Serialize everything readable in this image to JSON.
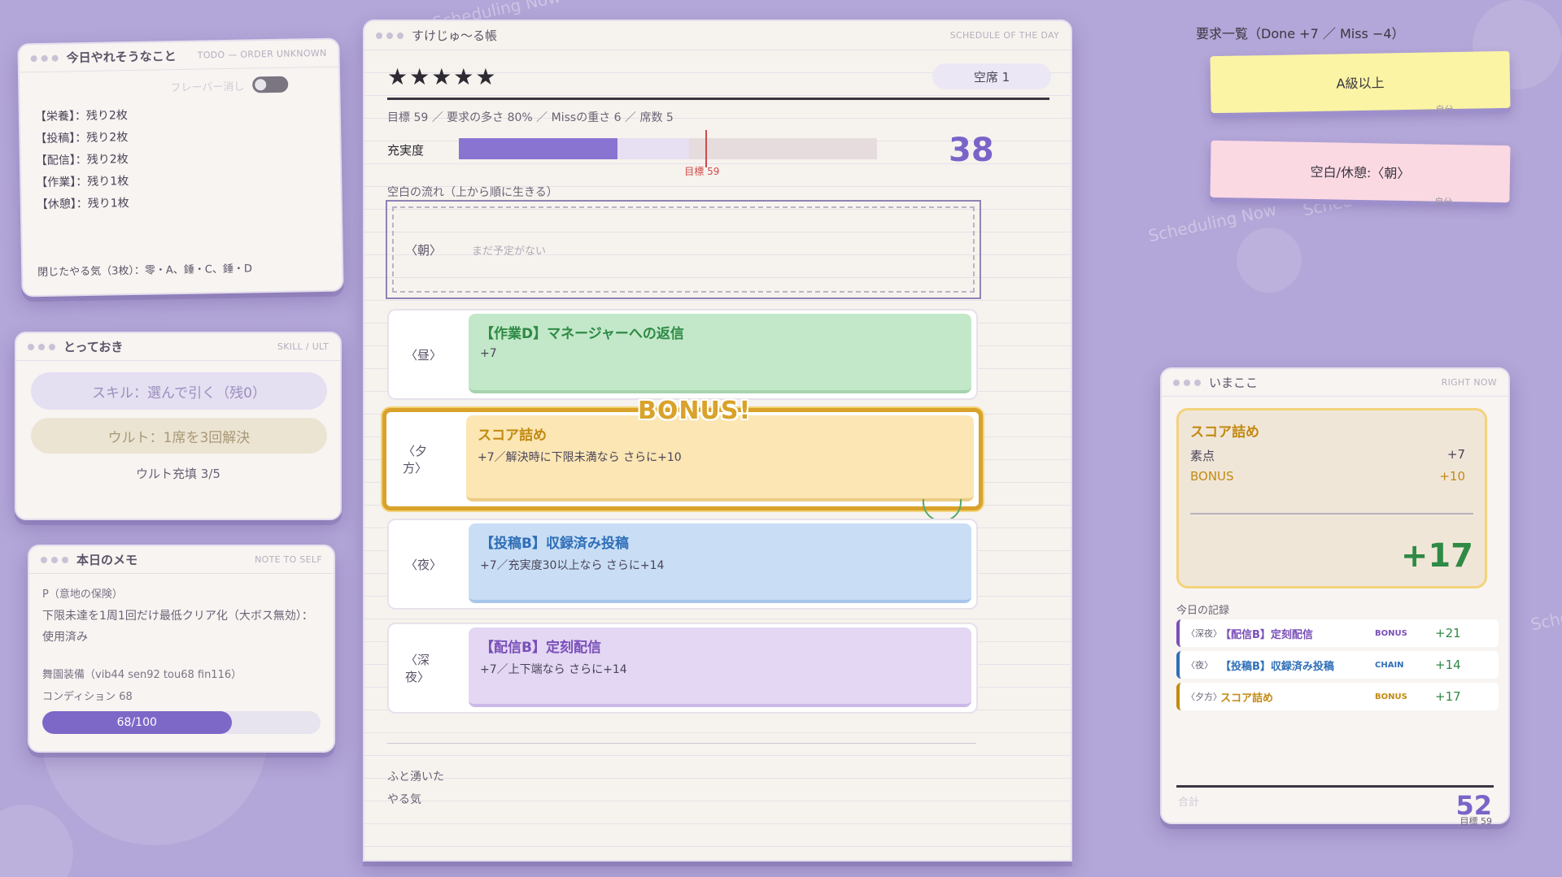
{
  "background": {
    "watermark": [
      "Scheduling Now",
      "Scheduling Now",
      "Scheduling Now",
      "Scheduling Now"
    ]
  },
  "todo": {
    "title": "今日やれそうなこと",
    "subtitle": "TODO — ORDER UNKNOWN",
    "toggle_label": "フレーバー消し",
    "items": [
      "【栄養】：残り2枚",
      "【投稿】：残り2枚",
      "【配信】：残り2枚",
      "【作業】：残り1枚",
      "【休憩】：残り1枚"
    ],
    "footer": "閉じたやる気（3枚）：零・A、錘・C、錘・D"
  },
  "skill": {
    "title": "とっておき",
    "subtitle": "SKILL / ULT",
    "skill_button": "スキル：選んで引く（残0）",
    "ult_button": "ウルト：1席を3回解決",
    "ult_charge": "ウルト充填 3/5"
  },
  "memo": {
    "title": "本日のメモ",
    "subtitle": "NOTE TO SELF",
    "line1": "P（意地の保険）",
    "line2": "下限未達を1周1回だけ最低クリア化（大ボス無効）：使用済み",
    "stage": "舞園装備（vib44 sen92 tou68 fin116）",
    "condition_label": "コンディション 68",
    "condition_value": 68,
    "condition_text": "68/100"
  },
  "main": {
    "title": "すけじゅ〜る帳",
    "subtitle": "SCHEDULE OF THE DAY",
    "stars": "★★★★★",
    "seats": "空席 1",
    "meta": "目標 59 ／ 要求の多さ 80% ／ Missの重さ 6 ／ 席数 5",
    "fill_label": "充実度",
    "fill_value": 38,
    "fill_preview": 55,
    "goal": 59,
    "goal_label": "目標 59",
    "score": "38",
    "flow_label": "空白の流れ（上から順に生きる）",
    "empty_slot_time": "〈朝〉",
    "empty_slot_text": "まだ予定がない",
    "slots": [
      {
        "time": "〈昼〉",
        "title": "【作業D】マネージャーへの返信",
        "desc": "+7"
      },
      {
        "time": "〈夕方〉",
        "title": "スコア詰め",
        "desc": "+7／解決時に下限未満なら さらに+10"
      },
      {
        "time": "〈夜〉",
        "title": "【投稿B】収録済み投稿",
        "desc": "+7／充実度30以上なら さらに+14"
      },
      {
        "time": "〈深夜〉",
        "title": "【配信B】定刻配信",
        "desc": "+7／上下端なら さらに+14"
      }
    ],
    "bonus_banner": "BONUS!",
    "whim_line1": "ふと湧いた",
    "whim_line2": "やる気"
  },
  "requests": {
    "title": "要求一覧（Done +7 ／ Miss −4）",
    "items": [
      {
        "label": "A級以上",
        "time": "—— 自分"
      },
      {
        "label": "空白/休憩:〈朝〉",
        "time": "—— 自分"
      }
    ]
  },
  "now": {
    "title": "いまここ",
    "subtitle": "RIGHT NOW",
    "card_name": "スコア詰め",
    "base_label": "素点",
    "base_value": "+7",
    "bonus_label": "BONUS",
    "bonus_value": "+10",
    "total": "+17",
    "log_label": "今日の記録",
    "log": [
      {
        "time": "〈深夜〉",
        "name": "【配信B】定刻配信",
        "tag": "BONUS",
        "value": "+21",
        "color": "#7a4fb8"
      },
      {
        "time": "〈夜〉",
        "name": "【投稿B】収録済み投稿",
        "tag": "CHAIN",
        "value": "+14",
        "color": "#2f6fb8"
      },
      {
        "time": "〈夕方〉",
        "name": "スコア詰め",
        "tag": "BONUS",
        "value": "+17",
        "color": "#c28a12"
      }
    ],
    "sum_label": "合計",
    "sum": "52",
    "goal": "目標 59"
  }
}
